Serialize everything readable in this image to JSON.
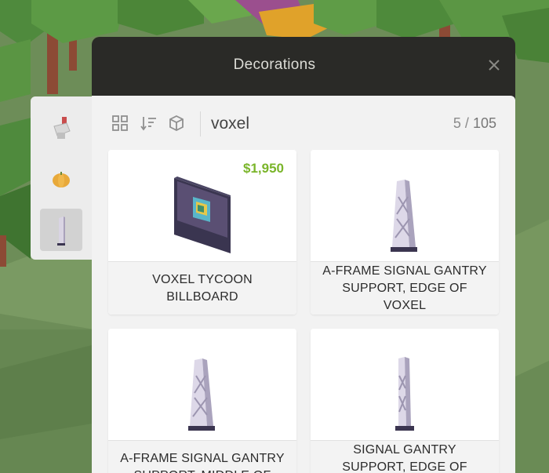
{
  "window": {
    "title": "Decorations",
    "close_icon": "close-icon"
  },
  "sidebar": {
    "items": [
      {
        "name": "sidebar-item-props",
        "icon": "lamp-prop-icon",
        "active": false
      },
      {
        "name": "sidebar-item-pumpkin",
        "icon": "pumpkin-icon",
        "active": false
      },
      {
        "name": "sidebar-item-gantry",
        "icon": "gantry-icon",
        "active": true
      }
    ]
  },
  "toolbar": {
    "grid_icon": "grid-view-icon",
    "sort_icon": "sort-icon",
    "cube_icon": "cube-icon",
    "search_value": "voxel",
    "count_shown": "5",
    "count_sep": "/",
    "count_total": "105"
  },
  "items": [
    {
      "label": "VOXEL TYCOON BILLBOARD",
      "price": "$1,950",
      "icon": "billboard-icon"
    },
    {
      "label": "A-FRAME SIGNAL GANTRY SUPPORT, EDGE OF VOXEL",
      "price": "",
      "icon": "a-frame-gantry-icon"
    },
    {
      "label": "A-FRAME SIGNAL GANTRY SUPPORT, MIDDLE OF",
      "price": "",
      "icon": "a-frame-gantry-middle-icon"
    },
    {
      "label": "SIGNAL GANTRY SUPPORT, EDGE OF VOXEL",
      "price": "",
      "icon": "gantry-support-icon"
    }
  ],
  "colors": {
    "price": "#7ab52a",
    "header": "#2a2a27",
    "panel": "#f2f2f2"
  }
}
